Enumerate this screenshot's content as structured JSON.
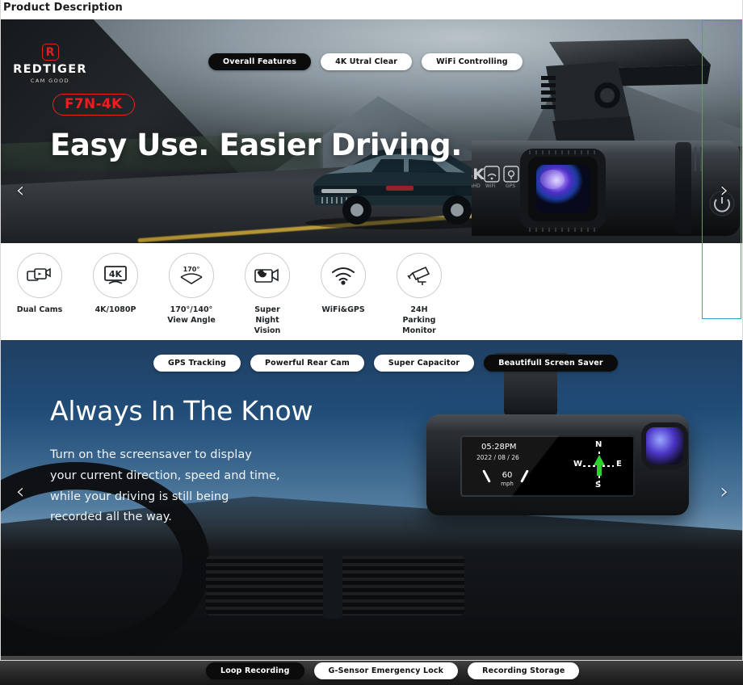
{
  "page": {
    "heading": "Product Description"
  },
  "banner1": {
    "logo": {
      "word": "REDTIGER",
      "sub": "CAM GOOD",
      "mark": "R"
    },
    "model_badge": "F7N-4K",
    "headline": "Easy Use.\nEasier Driving.",
    "tabs": [
      {
        "label": "Overall Features",
        "active": true
      },
      {
        "label": "4K Utral Clear",
        "active": false
      },
      {
        "label": "WiFi Controlling",
        "active": false
      }
    ],
    "nav": {
      "prev": "‹",
      "next": "›"
    },
    "device_badges": {
      "res": "4K",
      "res_sub": "UltraHD",
      "wifi": "WiFi",
      "gps": "GPS"
    }
  },
  "features": [
    {
      "label": "Dual Cams",
      "icon": "dual-camera-icon"
    },
    {
      "label": "4K/1080P",
      "icon": "monitor-4k-icon"
    },
    {
      "label": "170°/140°\nView Angle",
      "icon": "view-angle-icon",
      "angle": "170°"
    },
    {
      "label": "Super\nNight Vision",
      "icon": "night-vision-icon"
    },
    {
      "label": "WiFi&GPS",
      "icon": "wifi-icon"
    },
    {
      "label": "24H Parking\nMonitor",
      "icon": "security-camera-icon"
    }
  ],
  "banner2": {
    "tabs": [
      {
        "label": "GPS Tracking",
        "active": false
      },
      {
        "label": "Powerful Rear Cam",
        "active": false
      },
      {
        "label": "Super Capacitor",
        "active": false
      },
      {
        "label": "Beautifull Screen Saver",
        "active": true
      }
    ],
    "headline": "Always In The Know",
    "body": "Turn on the screensaver to display\nyour current direction, speed and time,\nwhile your driving is still being\nrecorded all the way.",
    "nav": {
      "prev": "‹",
      "next": "›"
    },
    "screen": {
      "time": "05:28PM",
      "date": "2022 / 08 / 26",
      "speed": "60",
      "speed_unit": "mph",
      "compass": {
        "n": "N",
        "s": "S",
        "w": "W",
        "e": "E"
      }
    }
  },
  "banner3": {
    "tabs": [
      {
        "label": "Loop Recording",
        "active": true
      },
      {
        "label": "G-Sensor Emergency Lock",
        "active": false
      },
      {
        "label": "Recording Storage",
        "active": false
      }
    ]
  },
  "colors": {
    "accent_red": "#ef1d1d",
    "focus_ring": "#2aa9bd",
    "tab_active_bg": "#0b0b0b",
    "banner2_blue": "#1d4a76",
    "compass_green": "#2fd02f"
  }
}
